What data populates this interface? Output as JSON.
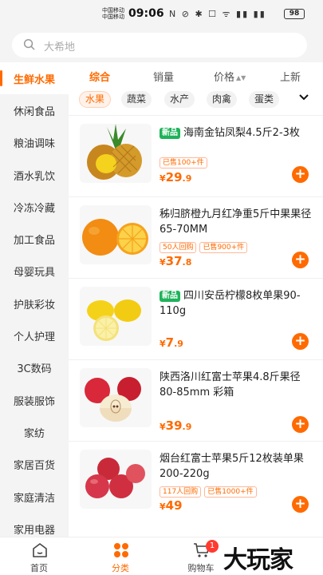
{
  "status_bar": {
    "carrier_1": "中国移动",
    "carrier_2": "中国移动",
    "time": "09:06",
    "icons": "N ⊘ ✱ ☐ ᯤ ▮▮ ▮▮",
    "battery": "98"
  },
  "search": {
    "placeholder": "大希地"
  },
  "sidebar": {
    "items": [
      {
        "label": "生鲜水果",
        "active": true
      },
      {
        "label": "休闲食品"
      },
      {
        "label": "粮油调味"
      },
      {
        "label": "酒水乳饮"
      },
      {
        "label": "冷冻冷藏"
      },
      {
        "label": "加工食品"
      },
      {
        "label": "母婴玩具"
      },
      {
        "label": "护肤彩妆"
      },
      {
        "label": "个人护理"
      },
      {
        "label": "3C数码"
      },
      {
        "label": "服装服饰"
      },
      {
        "label": "家纺"
      },
      {
        "label": "家居百货"
      },
      {
        "label": "家庭清洁"
      },
      {
        "label": "家用电器"
      }
    ]
  },
  "sort": {
    "comprehensive": "综合",
    "sales": "销量",
    "price": "价格",
    "price_arrows": "▲▼",
    "newest": "上新"
  },
  "chips": [
    "水果",
    "蔬菜",
    "水产",
    "肉禽",
    "蛋类"
  ],
  "products": [
    {
      "is_new": true,
      "new_label": "新品",
      "title": "海南金钻凤梨4.5斤2-3枚",
      "tags": [
        "已售100+件"
      ],
      "currency": "¥",
      "price_int": "29",
      "price_dec": ".9",
      "image": "pineapple"
    },
    {
      "is_new": false,
      "title": "秭归脐橙九月红净重5斤中果果径65-70MM",
      "tags": [
        "50人回购",
        "已售900+件"
      ],
      "currency": "¥",
      "price_int": "37",
      "price_dec": ".8",
      "image": "orange"
    },
    {
      "is_new": true,
      "new_label": "新品",
      "title": "四川安岳柠檬8枚单果90-110g",
      "tags": [],
      "currency": "¥",
      "price_int": "7",
      "price_dec": ".9",
      "image": "lemon"
    },
    {
      "is_new": false,
      "title": "陕西洛川红富士苹果4.8斤果径80-85mm 彩箱",
      "tags": [],
      "currency": "¥",
      "price_int": "39",
      "price_dec": ".9",
      "image": "apple"
    },
    {
      "is_new": false,
      "title": "烟台红富士苹果5斤12枚装单果200-220g",
      "tags": [
        "117人回购",
        "已售1000+件"
      ],
      "currency": "¥",
      "price_int": "49",
      "price_dec": "",
      "image": "apples"
    }
  ],
  "add_label": "+",
  "tabbar": {
    "home": "首页",
    "category": "分类",
    "cart": "购物车",
    "cart_badge": "1"
  },
  "watermark": "大玩家",
  "colors": {
    "accent": "#ff6a00",
    "new_tag": "#1fb35a",
    "badge": "#ff3b30"
  }
}
